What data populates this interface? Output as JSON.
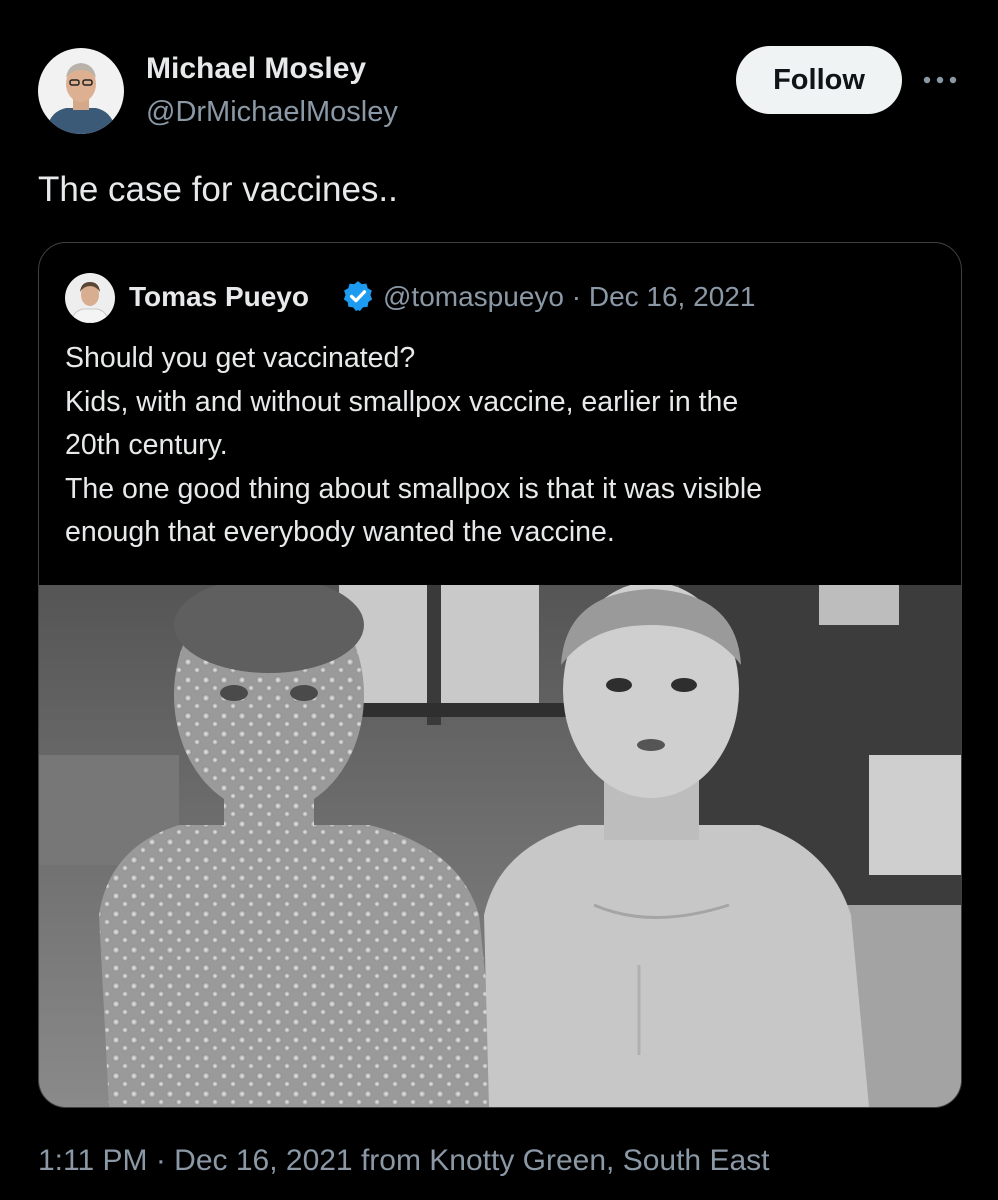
{
  "tweet": {
    "author": {
      "name": "Michael Mosley",
      "handle": "@DrMichaelMosley",
      "avatar_icon": "profile-photo"
    },
    "follow_label": "Follow",
    "more_icon": "ellipsis-icon",
    "text": "The case for vaccines..",
    "timestamp": "1:11 PM · Dec 16, 2021 from Knotty Green, South East"
  },
  "quote": {
    "author": {
      "name": "Tomas Pueyo",
      "verified": true,
      "verified_color": "#1d9bf0"
    },
    "meta": "@tomaspueyo · Dec 16, 2021",
    "lines": [
      "Should you get vaccinated?",
      "Kids, with and without smallpox vaccine, earlier in the",
      "20th century.",
      "The one good thing about smallpox is that it was visible",
      "enough that everybody wanted the vaccine."
    ]
  },
  "colors": {
    "background": "#000000",
    "text_primary": "#e7e9ea",
    "text_secondary": "#8b98a5",
    "follow_bg": "#eff3f4",
    "border": "#3e4144"
  }
}
